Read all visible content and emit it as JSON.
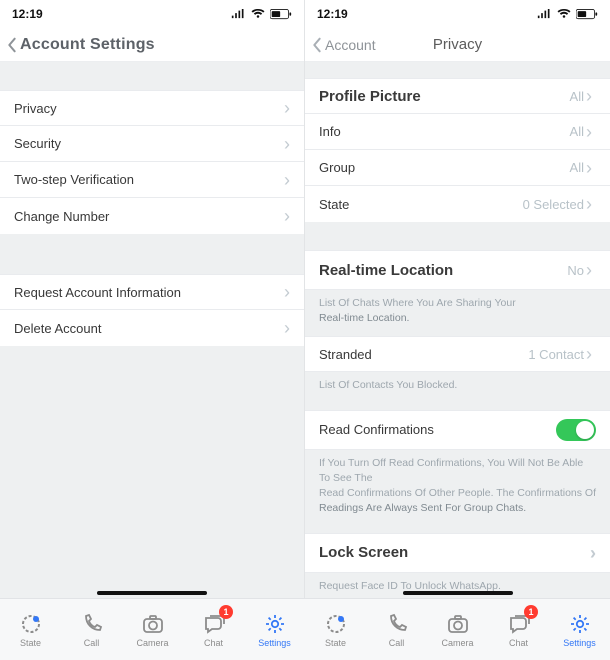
{
  "status": {
    "time": "12:19"
  },
  "left": {
    "headerTitle": "Account Settings",
    "rowsA": [
      {
        "label": "Privacy"
      },
      {
        "label": "Security"
      },
      {
        "label": "Two-step Verification"
      },
      {
        "label": "Change Number"
      }
    ],
    "rowsB": [
      {
        "label": "Request Account Information"
      },
      {
        "label": "Delete Account"
      }
    ]
  },
  "right": {
    "backLabel": "Account",
    "headerTitle": "Privacy",
    "rows1": [
      {
        "label": "Profile Picture",
        "value": "All",
        "big": true
      },
      {
        "label": "Info",
        "value": "All"
      },
      {
        "label": "Group",
        "value": "All"
      },
      {
        "label": "State",
        "value": "0 Selected"
      }
    ],
    "rtl": {
      "label": "Real-time Location",
      "value": "No"
    },
    "rtlCaption1": "List Of Chats Where You Are Sharing Your",
    "rtlCaption2": "Real-time Location.",
    "stranded": {
      "label": "Stranded",
      "value": "1 Contact"
    },
    "strandedCaption": "List Of Contacts You Blocked.",
    "readConf": {
      "label": "Read Confirmations"
    },
    "readConfCaption1": "If You Turn Off Read Confirmations, You Will Not Be Able To See The",
    "readConfCaption2": "Read Confirmations Of Other People. The Confirmations Of",
    "readConfCaption3": "Readings Are Always Sent For Group Chats.",
    "lock": {
      "label": "Lock Screen"
    },
    "lockCaption": "Request Face ID To Unlock WhatsApp."
  },
  "tabs": [
    {
      "label": "State",
      "icon": "circle-dot"
    },
    {
      "label": "Call",
      "icon": "phone"
    },
    {
      "label": "Camera",
      "icon": "camera"
    },
    {
      "label": "Chat",
      "icon": "chat",
      "badge": "1"
    },
    {
      "label": "Settings",
      "icon": "gear",
      "active": true
    }
  ]
}
